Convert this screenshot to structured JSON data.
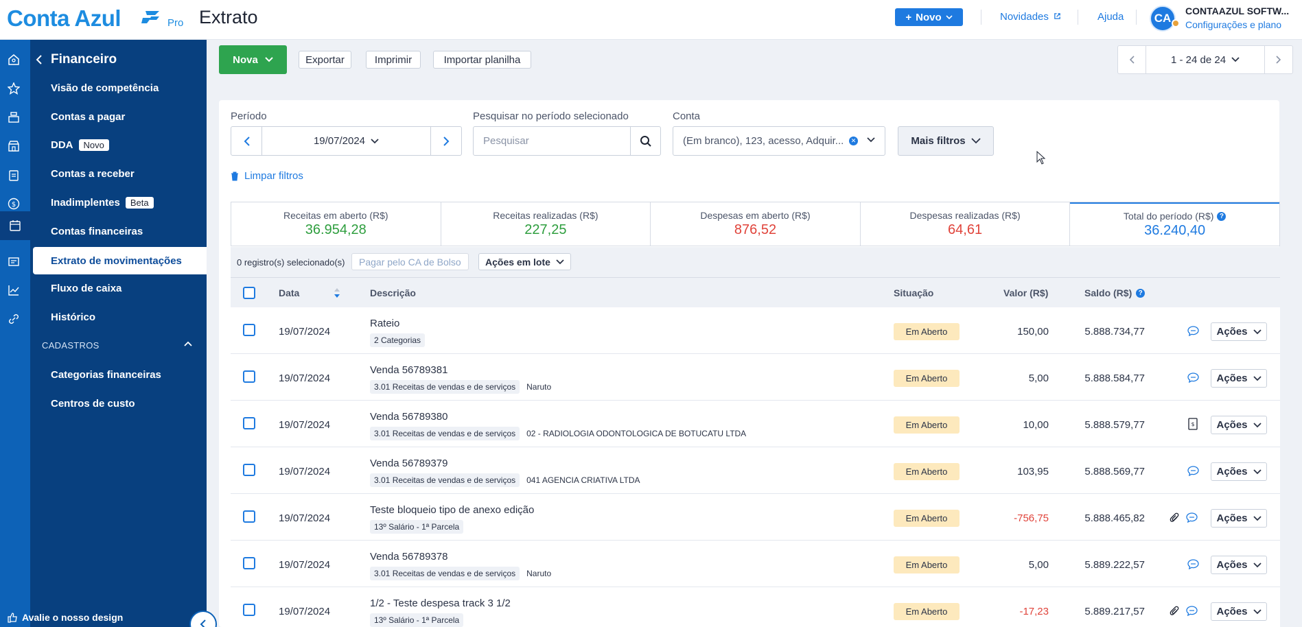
{
  "app": {
    "logo_text": "Conta Azul",
    "logo_tier": "Pro",
    "page_title": "Extrato"
  },
  "header": {
    "novo_label": "Novo",
    "novidades_label": "Novidades",
    "ajuda_label": "Ajuda",
    "avatar_initials": "CA",
    "company_name": "CONTAAZUL SOFTW...",
    "company_link": "Configurações e plano"
  },
  "sidebar": {
    "title": "Financeiro",
    "items": [
      {
        "label": "Visão de competência"
      },
      {
        "label": "Contas a pagar"
      },
      {
        "label": "DDA",
        "badge": "Novo"
      },
      {
        "label": "Contas a receber"
      },
      {
        "label": "Inadimplentes",
        "badge": "Beta"
      },
      {
        "label": "Contas financeiras"
      },
      {
        "label": "Extrato de movimentações",
        "active": true
      },
      {
        "label": "Fluxo de caixa"
      },
      {
        "label": "Histórico"
      }
    ],
    "section_label": "CADASTROS",
    "section_items": [
      {
        "label": "Categorias financeiras"
      },
      {
        "label": "Centros de custo"
      }
    ],
    "footer_label": "Avalie o nosso design"
  },
  "toolbar": {
    "nova_label": "Nova",
    "exportar_label": "Exportar",
    "imprimir_label": "Imprimir",
    "importar_label": "Importar planilha",
    "pager_text": "1 - 24 de 24"
  },
  "filters": {
    "periodo_label": "Período",
    "periodo_value": "19/07/2024",
    "search_label": "Pesquisar no período selecionado",
    "search_placeholder": "Pesquisar",
    "conta_label": "Conta",
    "conta_value": "(Em branco), 123, acesso, Adquir...",
    "mais_filtros_label": "Mais filtros",
    "limpar_label": "Limpar filtros"
  },
  "summary": [
    {
      "label": "Receitas em aberto (R$)",
      "value": "36.954,28",
      "color": "#2e9e3e"
    },
    {
      "label": "Receitas realizadas (R$)",
      "value": "227,25",
      "color": "#2e9e3e"
    },
    {
      "label": "Despesas em aberto (R$)",
      "value": "876,52",
      "color": "#e0433a"
    },
    {
      "label": "Despesas realizadas (R$)",
      "value": "64,61",
      "color": "#e0433a"
    },
    {
      "label": "Total do período (R$)",
      "value": "36.240,40",
      "color": "#1e7ae0"
    }
  ],
  "batch": {
    "count_text": "0 registro(s) selecionado(s)",
    "pagar_label": "Pagar pelo CA de Bolso",
    "acoes_lote_label": "Ações em lote"
  },
  "table": {
    "columns": {
      "data": "Data",
      "descricao": "Descrição",
      "situacao": "Situação",
      "valor": "Valor (R$)",
      "saldo": "Saldo (R$)"
    },
    "action_label": "Ações",
    "rows": [
      {
        "date": "19/07/2024",
        "desc": "Rateio",
        "tag": "2 Categorias",
        "extra": "",
        "status": "Em Aberto",
        "valor": "150,00",
        "negative": false,
        "saldo": "5.888.734,77",
        "icon": "comment-icon",
        "clip": false
      },
      {
        "date": "19/07/2024",
        "desc": "Venda 56789381",
        "tag": "3.01 Receitas de vendas e de serviços",
        "extra": "Naruto",
        "status": "Em Aberto",
        "valor": "5,00",
        "negative": false,
        "saldo": "5.888.584,77",
        "icon": "comment-icon",
        "clip": false
      },
      {
        "date": "19/07/2024",
        "desc": "Venda 56789380",
        "tag": "3.01 Receitas de vendas e de serviços",
        "extra": "02 - RADIOLOGIA ODONTOLOGICA DE BOTUCATU LTDA",
        "status": "Em Aberto",
        "valor": "10,00",
        "negative": false,
        "saldo": "5.888.579,77",
        "icon": "invoice-icon",
        "clip": false
      },
      {
        "date": "19/07/2024",
        "desc": "Venda 56789379",
        "tag": "3.01 Receitas de vendas e de serviços",
        "extra": "041 AGENCIA CRIATIVA LTDA",
        "status": "Em Aberto",
        "valor": "103,95",
        "negative": false,
        "saldo": "5.888.569,77",
        "icon": "comment-icon",
        "clip": false
      },
      {
        "date": "19/07/2024",
        "desc": "Teste bloqueio tipo de anexo edição",
        "tag": "13º Salário - 1ª Parcela",
        "extra": "",
        "status": "Em Aberto",
        "valor": "-756,75",
        "negative": true,
        "saldo": "5.888.465,82",
        "icon": "comment-icon",
        "clip": true
      },
      {
        "date": "19/07/2024",
        "desc": "Venda 56789378",
        "tag": "3.01 Receitas de vendas e de serviços",
        "extra": "Naruto",
        "status": "Em Aberto",
        "valor": "5,00",
        "negative": false,
        "saldo": "5.889.222,57",
        "icon": "comment-icon",
        "clip": false
      },
      {
        "date": "19/07/2024",
        "desc": "1/2 - Teste despesa track 3 1/2",
        "tag": "13º Salário - 1ª Parcela",
        "extra": "",
        "status": "Em Aberto",
        "valor": "-17,23",
        "negative": true,
        "saldo": "5.889.217,57",
        "icon": "comment-icon",
        "clip": true
      }
    ]
  },
  "colors": {
    "brand": "#1d8ce0",
    "sidebar": "#08407f",
    "rail": "#0d62b7",
    "primary_green": "#2ea44f",
    "status_open": "#fde9bd"
  }
}
